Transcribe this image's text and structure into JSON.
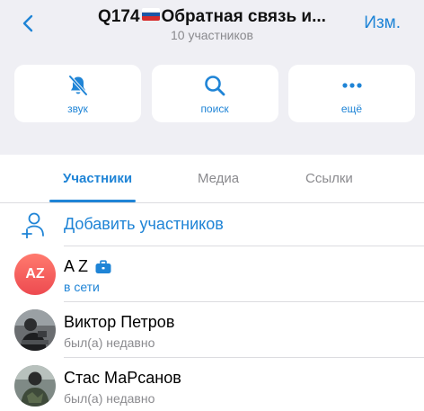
{
  "header": {
    "back_icon": "chevron-left-icon",
    "title_prefix": "Q174",
    "title_flag": "russia-flag",
    "title_text": "Обратная связь и...",
    "subtitle": "10 участников",
    "edit_label": "Изм."
  },
  "actions": [
    {
      "label": "звук",
      "icon": "bell-slash-icon"
    },
    {
      "label": "поиск",
      "icon": "search-icon"
    },
    {
      "label": "ещё",
      "icon": "more-icon"
    }
  ],
  "tabs": [
    {
      "label": "Участники",
      "active": true
    },
    {
      "label": "Медиа",
      "active": false
    },
    {
      "label": "Ссылки",
      "active": false
    }
  ],
  "add_members": {
    "label": "Добавить участников",
    "icon": "add-person-icon"
  },
  "members": [
    {
      "name": "A Z",
      "initials": "AZ",
      "status": "в сети",
      "online": true,
      "badge_icon": "briefcase-icon"
    },
    {
      "name": "Виктор Петров",
      "status": "был(а) недавно",
      "online": false
    },
    {
      "name": "Стас МаРсанов",
      "status": "был(а) недавно",
      "online": false
    }
  ],
  "colors": {
    "accent": "#1f84d6",
    "background_top": "#efeff4",
    "secondary_text": "#8a8a8e"
  }
}
